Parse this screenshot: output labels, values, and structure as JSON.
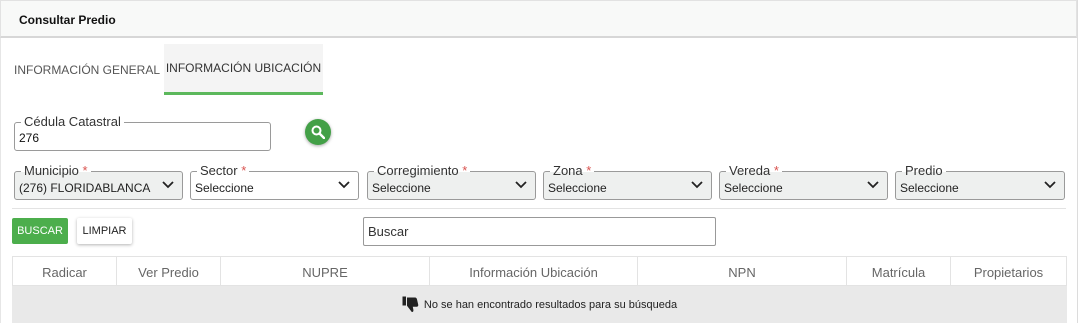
{
  "header": {
    "title": "Consultar Predio"
  },
  "tabs": [
    {
      "label": "INFORMACIÓN GENERAL",
      "active": false
    },
    {
      "label": "INFORMACIÓN UBICACIÓN",
      "active": true
    }
  ],
  "cedula": {
    "label": "Cédula Catastral",
    "value": "276"
  },
  "filters": [
    {
      "label": "Municipio",
      "required": true,
      "value": "(276) FLORIDABLANCA"
    },
    {
      "label": "Sector",
      "required": true,
      "value": "Seleccione"
    },
    {
      "label": "Corregimiento",
      "required": true,
      "value": "Seleccione"
    },
    {
      "label": "Zona",
      "required": true,
      "value": "Seleccione"
    },
    {
      "label": "Vereda",
      "required": true,
      "value": "Seleccione"
    },
    {
      "label": "Predio",
      "required": false,
      "value": "Seleccione"
    }
  ],
  "required_mark": "*",
  "actions": {
    "search_label": "BUSCAR",
    "clear_label": "LIMPIAR"
  },
  "table": {
    "search_placeholder": "Buscar",
    "columns": [
      "Radicar",
      "Ver Predio",
      "NUPRE",
      "Información Ubicación",
      "NPN",
      "Matrícula",
      "Propietarios"
    ],
    "empty_message": "No se han encontrado resultados para su búsqueda"
  },
  "colors": {
    "accent": "#5cb85c",
    "search_button": "#43a047",
    "required": "#d9534f"
  },
  "icons": {
    "search": "search-icon",
    "dropdown": "chevron-down-icon",
    "empty": "thumbs-down-icon"
  }
}
